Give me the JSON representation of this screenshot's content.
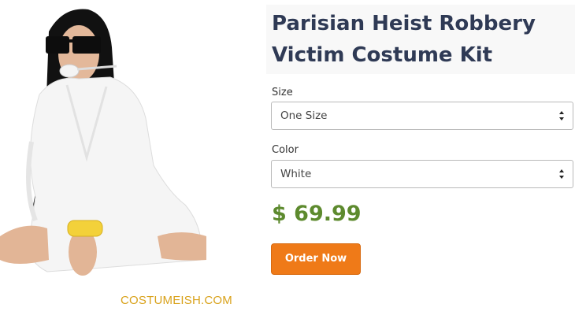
{
  "product": {
    "title": "Parisian Heist Robbery Victim Costume Kit",
    "watermark": "COSTUMEISH.COM",
    "image_alt_icon": "costume-model-photo"
  },
  "options": {
    "size": {
      "label": "Size",
      "value": "One Size"
    },
    "color": {
      "label": "Color",
      "value": "White"
    }
  },
  "price": "$ 69.99",
  "actions": {
    "order_label": "Order Now"
  },
  "colors": {
    "title": "#2f3a55",
    "price": "#5d8a2e",
    "button": "#ef7a18",
    "watermark": "#d9a21b"
  }
}
